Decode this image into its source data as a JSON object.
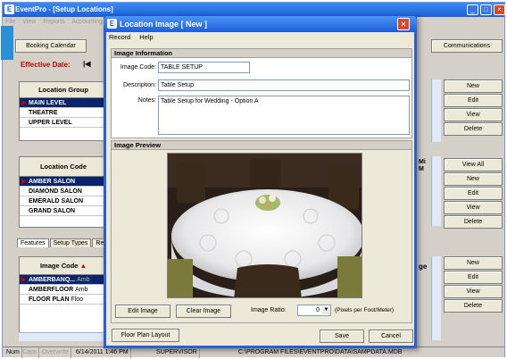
{
  "main_window": {
    "title": "EventPro - [Setup Locations]",
    "menu": [
      "File",
      "View",
      "Reports",
      "Accounting"
    ],
    "toolbar": {
      "booking_calendar": "Booking Calendar",
      "communications": "Communications"
    },
    "effective_date_label": "Effective Date:",
    "location_group": {
      "header": "Location Group",
      "rows": [
        "MAIN LEVEL",
        "THEATRE",
        "UPPER LEVEL"
      ],
      "buttons": [
        "New",
        "Edit",
        "View",
        "Delete"
      ]
    },
    "location_code": {
      "header": "Location Code",
      "rows": [
        "AMBER SALON",
        "DIAMOND SALON",
        "EMERALD SALON",
        "GRAND SALON"
      ],
      "buttons": [
        "View All",
        "New",
        "Edit",
        "View",
        "Delete"
      ],
      "right_header": "Mi M"
    },
    "tabs": [
      "Features",
      "Setup Types",
      "Re"
    ],
    "image_code": {
      "header": "Image Code",
      "rows": [
        {
          "code": "AMBERBANQ...",
          "desc": "Amb"
        },
        {
          "code": "AMBERFLOOR",
          "desc": "Amb"
        },
        {
          "code": "FLOOR PLAN",
          "desc": "Floo"
        }
      ],
      "right_header": "ge",
      "buttons": [
        "New",
        "Edit",
        "View",
        "Delete"
      ]
    },
    "status": {
      "num": "Num",
      "caps": "Caps",
      "overwrite": "Overwrite",
      "datetime": "6/14/2011 1:46 PM",
      "user": "SUPERVISOR",
      "path": "C:\\PROGRAM FILES\\EVENTPRO\\DATA\\SAMPDATA.MDB"
    }
  },
  "dialog": {
    "title": "Location Image [ New ]",
    "menu": [
      "Record",
      "Help"
    ],
    "info_title": "Image Information",
    "image_code_label": "Image Code:",
    "image_code_value": "TABLE SETUP",
    "description_label": "Description:",
    "description_value": "Table Setup",
    "notes_label": "Notes:",
    "notes_value": "Table Setup for Wedding - Option A",
    "preview_title": "Image Preview",
    "edit_image": "Edit Image",
    "clear_image": "Clear Image",
    "ratio_label": "Image Ratio:",
    "ratio_value": "0",
    "ratio_unit": "(Pixels per Foot/Meter)",
    "floor_plan_layout": "Floor Plan Layout",
    "save": "Save",
    "cancel": "Cancel"
  },
  "colors": {
    "selected_row": "#0a246a",
    "titlebar": "#1d5dd6",
    "effective_date": "#c00000"
  }
}
